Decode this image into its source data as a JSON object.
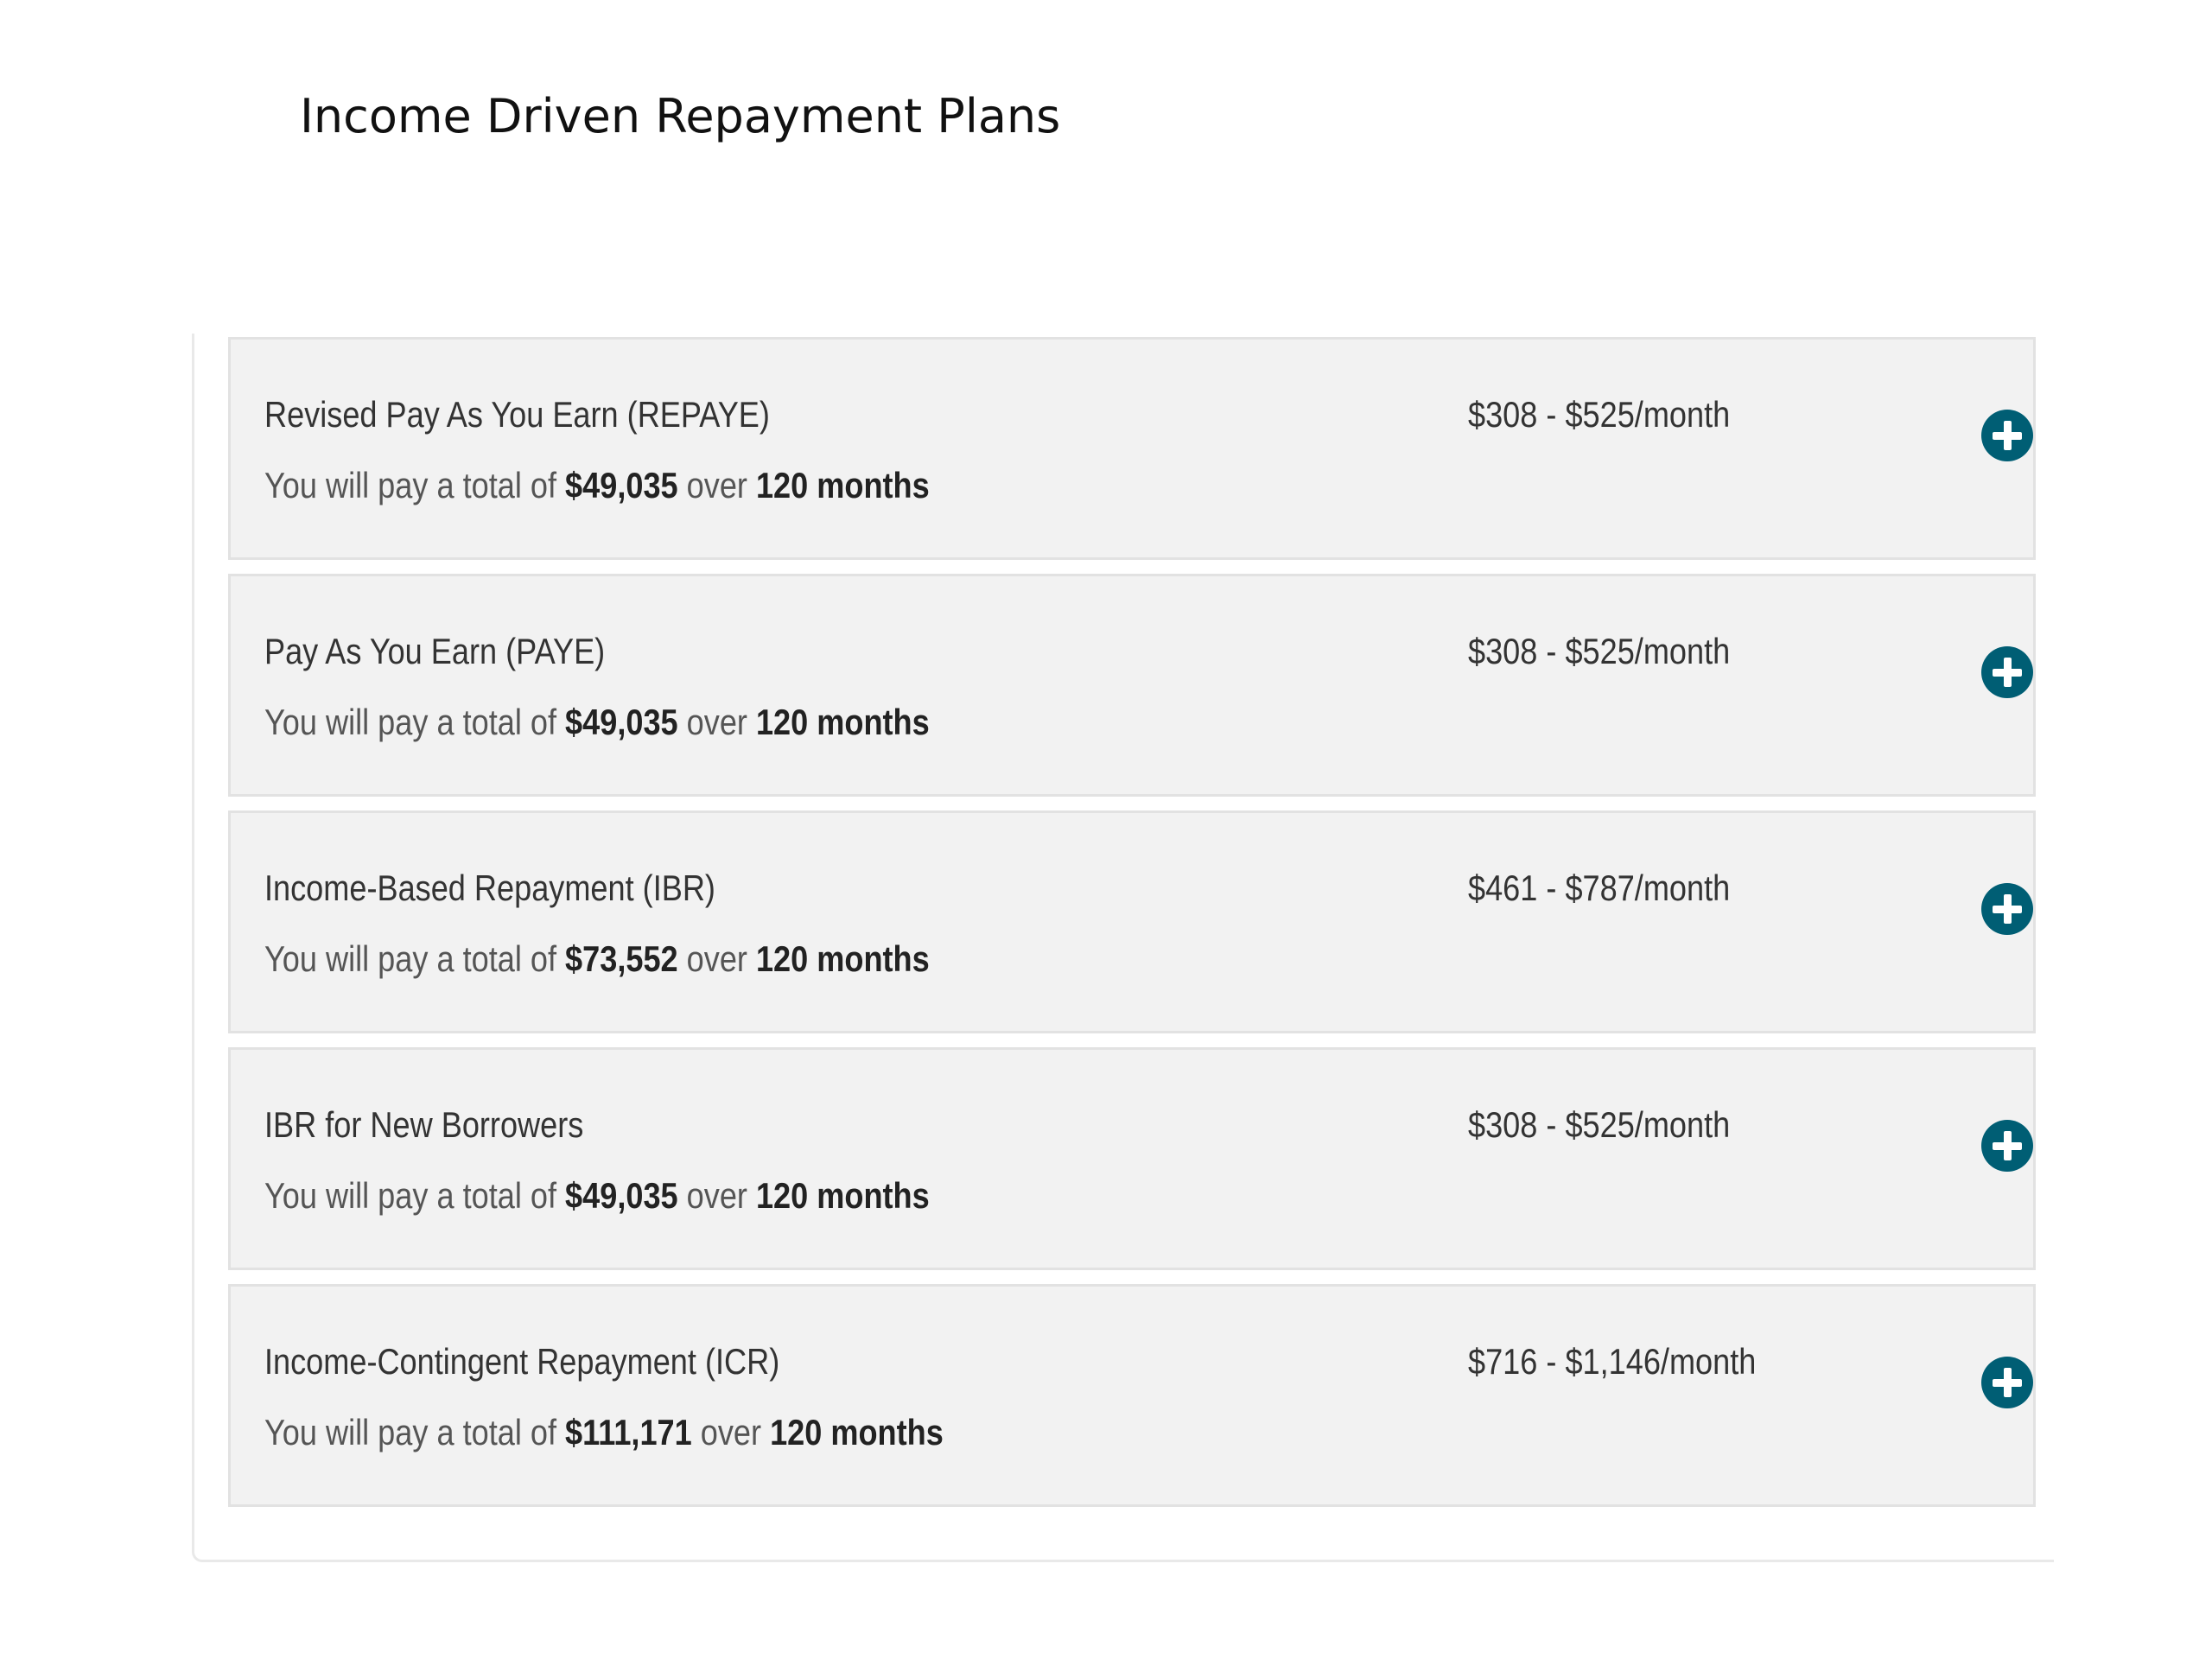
{
  "page": {
    "title": "Income Driven Repayment Plans"
  },
  "summary_template": {
    "prefix": "You will pay a total of",
    "between": "over"
  },
  "colors": {
    "accent": "#005e74",
    "card_background": "#f2f2f2",
    "card_border": "#e2e2e2"
  },
  "plans": [
    {
      "name": "Revised Pay As You Earn (REPAYE)",
      "monthly_range": "$308 - $525/month",
      "total": "$49,035",
      "term": "120 months",
      "icon": "plus-circle-icon"
    },
    {
      "name": "Pay As You Earn (PAYE)",
      "monthly_range": "$308 - $525/month",
      "total": "$49,035",
      "term": "120 months",
      "icon": "plus-circle-icon"
    },
    {
      "name": "Income-Based Repayment (IBR)",
      "monthly_range": "$461 - $787/month",
      "total": "$73,552",
      "term": "120 months",
      "icon": "plus-circle-icon"
    },
    {
      "name": "IBR for New Borrowers",
      "monthly_range": "$308 - $525/month",
      "total": "$49,035",
      "term": "120 months",
      "icon": "plus-circle-icon"
    },
    {
      "name": "Income-Contingent Repayment (ICR)",
      "monthly_range": "$716 - $1,146/month",
      "total": "$111,171",
      "term": "120 months",
      "icon": "plus-circle-icon"
    }
  ]
}
